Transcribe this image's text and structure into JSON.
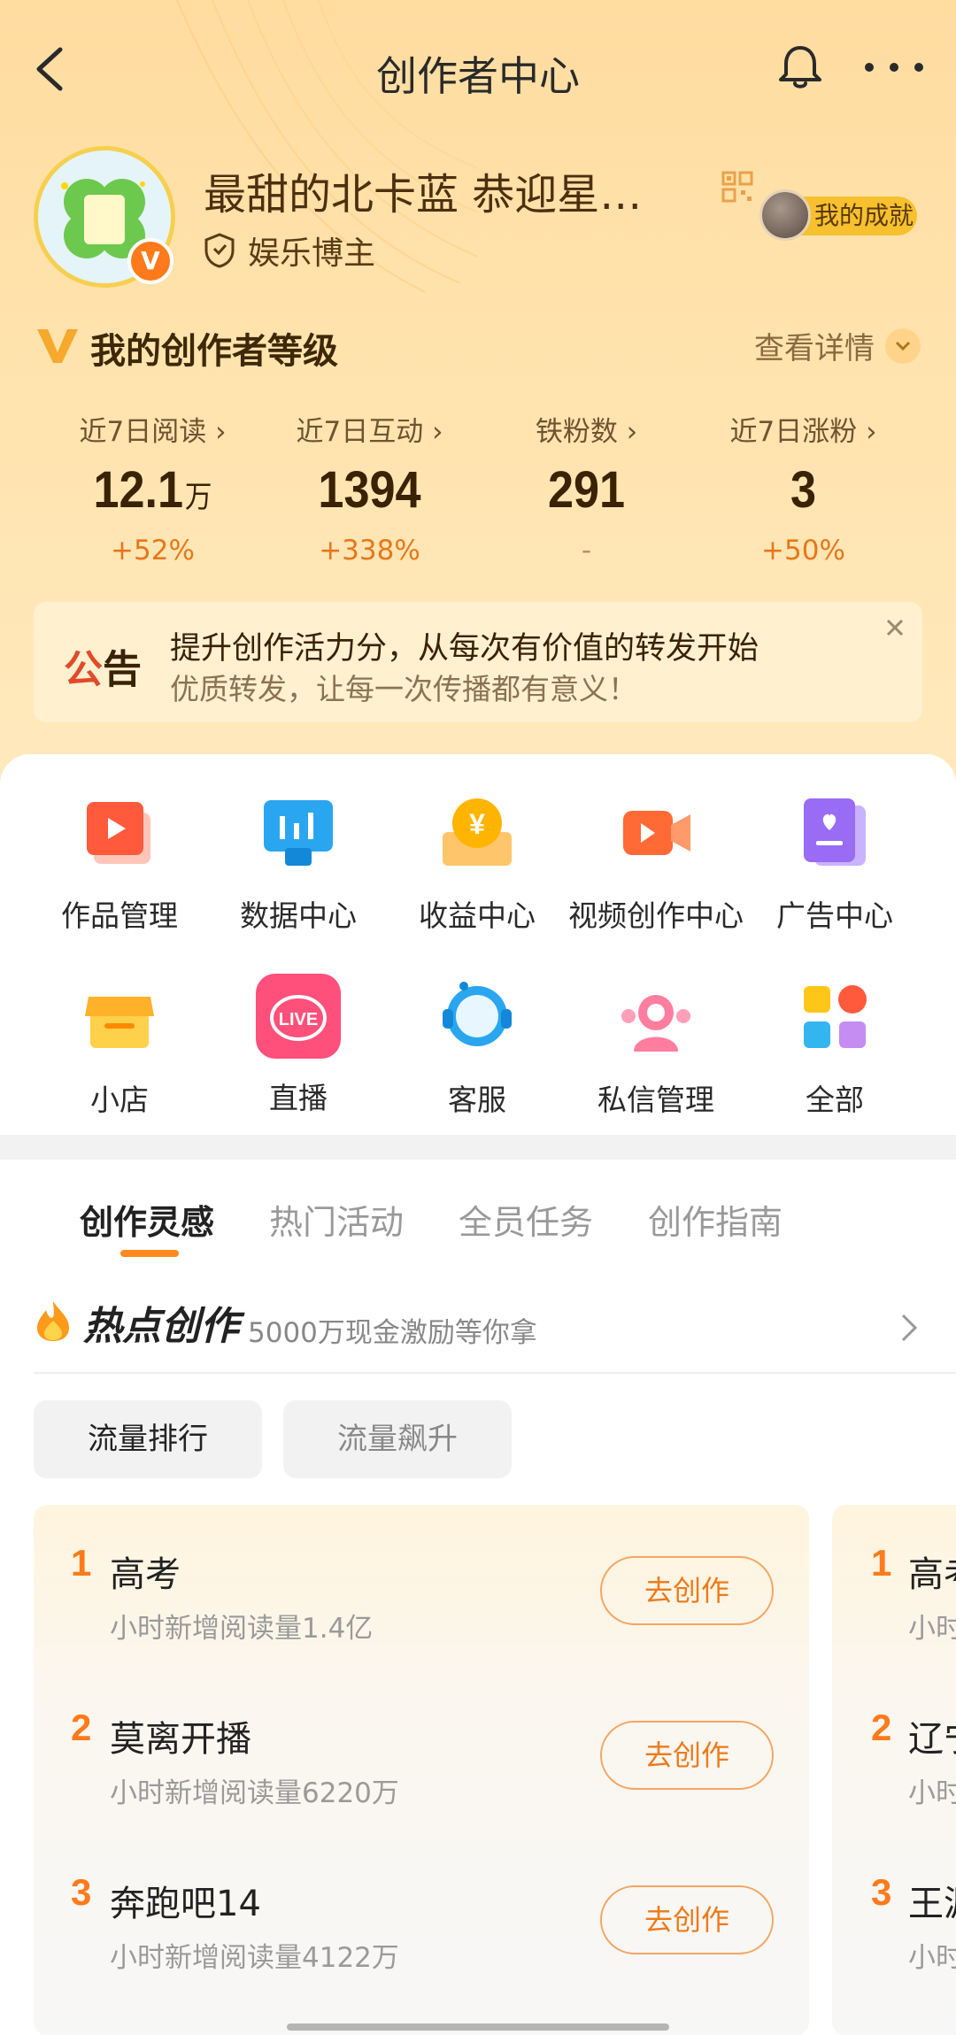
{
  "nav": {
    "title": "创作者中心"
  },
  "profile": {
    "name": "最甜的北卡蓝  恭迎星…",
    "role": "娱乐博主",
    "achievement": "我的成就",
    "verified": "V"
  },
  "level": {
    "title": "我的创作者等级",
    "detail": "查看详情"
  },
  "stats": [
    {
      "label": "近7日阅读",
      "value": "12.1",
      "unit": "万",
      "delta": "+52%"
    },
    {
      "label": "近7日互动",
      "value": "1394",
      "unit": "",
      "delta": "+338%"
    },
    {
      "label": "铁粉数",
      "value": "291",
      "unit": "",
      "delta": "-"
    },
    {
      "label": "近7日涨粉",
      "value": "3",
      "unit": "",
      "delta": "+50%"
    }
  ],
  "notice": {
    "tag_a": "公",
    "tag_b": "告",
    "line1": "提升创作活力分，从每次有价值的转发开始",
    "line2": "优质转发，让每一次传播都有意义！"
  },
  "grid": [
    {
      "label": "作品管理",
      "icon": "works-icon"
    },
    {
      "label": "数据中心",
      "icon": "data-center-icon"
    },
    {
      "label": "收益中心",
      "icon": "income-icon"
    },
    {
      "label": "视频创作中心",
      "icon": "video-camera-icon"
    },
    {
      "label": "广告中心",
      "icon": "ad-icon"
    },
    {
      "label": "小店",
      "icon": "shop-icon"
    },
    {
      "label": "直播",
      "icon": "live-icon"
    },
    {
      "label": "客服",
      "icon": "customer-service-icon"
    },
    {
      "label": "私信管理",
      "icon": "messages-icon"
    },
    {
      "label": "全部",
      "icon": "all-apps-icon"
    }
  ],
  "live_badge": "LIVE",
  "income_glyph": "¥",
  "tabs": [
    "创作灵感",
    "热门活动",
    "全员任务",
    "创作指南"
  ],
  "hot": {
    "title": "热点创作",
    "subtitle": "5000万现金激励等你拿"
  },
  "chips": [
    "流量排行",
    "流量飙升"
  ],
  "trending": [
    {
      "rank": "1",
      "name": "高考",
      "meta": "小时新增阅读量1.4亿",
      "button": "去创作"
    },
    {
      "rank": "2",
      "name": "莫离开播",
      "meta": "小时新增阅读量6220万",
      "button": "去创作"
    },
    {
      "rank": "3",
      "name": "奔跑吧14",
      "meta": "小时新增阅读量4122万",
      "button": "去创作"
    }
  ],
  "trending_peek": [
    {
      "rank": "1",
      "name": "高考",
      "meta": "小时"
    },
    {
      "rank": "2",
      "name": "辽宁",
      "meta": "小时"
    },
    {
      "rank": "3",
      "name": "王源",
      "meta": "小时"
    }
  ],
  "colors": {
    "accent": "#ff7a1a",
    "header_bg": "#ffdca0",
    "brand_red": "#e14a2a"
  }
}
